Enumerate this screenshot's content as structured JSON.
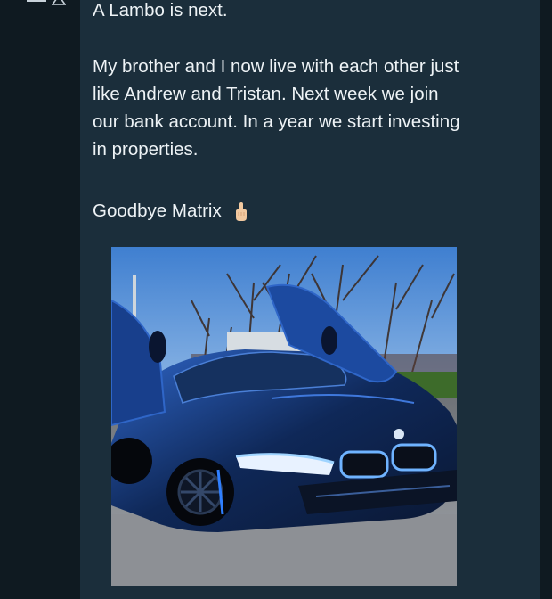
{
  "post": {
    "first_line": "A Lambo is next.",
    "paragraph_lines": [
      "My brother and I now live with each other just",
      "like Andrew and Tristan. Next week we join",
      "our bank account. In a year we start investing",
      "in properties."
    ],
    "sign_off": "Goodbye Matrix",
    "emoji": "hand-pointing-up-icon"
  },
  "photo": {
    "subject": "car-photo",
    "colors": {
      "sky": "#4f8fd6",
      "car_body": "#102a5a",
      "car_highlight": "#2f66c8",
      "grass": "#3d6b2a",
      "gravel": "#8a8d92"
    }
  },
  "theme": {
    "background": "#0f1a21",
    "card": "#1b2e3b",
    "text": "#eef3f6"
  }
}
